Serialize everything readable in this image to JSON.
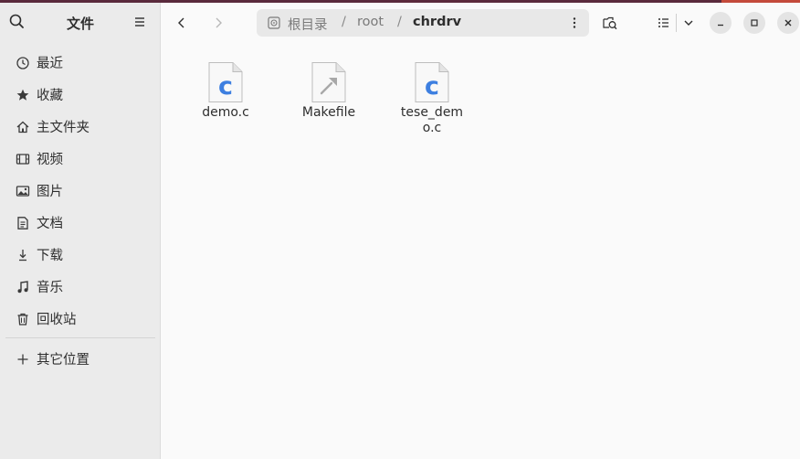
{
  "sidebar": {
    "title": "文件",
    "items": [
      {
        "label": "最近",
        "icon": "recent-icon"
      },
      {
        "label": "收藏",
        "icon": "star-icon"
      },
      {
        "label": "主文件夹",
        "icon": "home-icon"
      },
      {
        "label": "视频",
        "icon": "video-icon"
      },
      {
        "label": "图片",
        "icon": "image-icon"
      },
      {
        "label": "文档",
        "icon": "document-icon"
      },
      {
        "label": "下载",
        "icon": "download-icon"
      },
      {
        "label": "音乐",
        "icon": "music-icon"
      },
      {
        "label": "回收站",
        "icon": "trash-icon"
      }
    ],
    "other": {
      "label": "其它位置",
      "icon": "plus-icon"
    }
  },
  "path": {
    "segments": [
      "根目录",
      "root",
      "chrdrv"
    ],
    "separator": "/"
  },
  "files": [
    {
      "name": "demo.c",
      "type": "c-source"
    },
    {
      "name": "Makefile",
      "type": "makefile"
    },
    {
      "name": "tese_demo.c",
      "type": "c-source"
    }
  ],
  "colors": {
    "accent_blue": "#3d7fe0",
    "sidebar_bg": "#ebebeb",
    "content_bg": "#fafafa"
  }
}
